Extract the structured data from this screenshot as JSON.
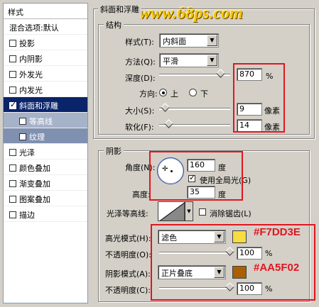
{
  "watermark": "www.68ps.com",
  "left_list": {
    "header": "样式",
    "items": [
      {
        "label": "混合选项:默认",
        "checkbox": false,
        "checked": false
      },
      {
        "label": "投影",
        "checkbox": true,
        "checked": false
      },
      {
        "label": "内阴影",
        "checkbox": true,
        "checked": false
      },
      {
        "label": "外发光",
        "checkbox": true,
        "checked": false
      },
      {
        "label": "内发光",
        "checkbox": true,
        "checked": false
      },
      {
        "label": "斜面和浮雕",
        "checkbox": true,
        "checked": true
      },
      {
        "label": "等高线",
        "checkbox": true,
        "checked": false
      },
      {
        "label": "纹理",
        "checkbox": true,
        "checked": false
      },
      {
        "label": "光泽",
        "checkbox": true,
        "checked": false
      },
      {
        "label": "颜色叠加",
        "checkbox": true,
        "checked": false
      },
      {
        "label": "渐变叠加",
        "checkbox": true,
        "checked": false
      },
      {
        "label": "图案叠加",
        "checkbox": true,
        "checked": false
      },
      {
        "label": "描边",
        "checkbox": true,
        "checked": false
      }
    ]
  },
  "bevel": {
    "title": "斜面和浮雕",
    "structure_title": "结构",
    "style_label": "样式(T):",
    "style_value": "内斜面",
    "technique_label": "方法(Q):",
    "technique_value": "平滑",
    "depth_label": "深度(D):",
    "depth_value": "870",
    "depth_unit": "%",
    "direction_label": "方向:",
    "direction_up": "上",
    "direction_down": "下",
    "size_label": "大小(S):",
    "size_value": "9",
    "size_unit": "像素",
    "soften_label": "软化(F):",
    "soften_value": "14",
    "soften_unit": "像素"
  },
  "shading": {
    "title": "阴影",
    "angle_label": "角度(N):",
    "angle_value": "160",
    "angle_unit": "度",
    "global_light_label": "使用全局光(G)",
    "altitude_label": "高度:",
    "altitude_value": "35",
    "altitude_unit": "度",
    "gloss_label": "光泽等高线:",
    "antialias_label": "消除锯齿(L)",
    "highlight_mode_label": "高光模式(H):",
    "highlight_mode_value": "滤色",
    "highlight_color": "#F7DD3E",
    "highlight_hex": "#F7DD3E",
    "opacity_label": "不透明度(O):",
    "highlight_opacity": "100",
    "opacity_unit": "%",
    "shadow_mode_label": "阴影模式(A):",
    "shadow_mode_value": "正片叠底",
    "shadow_color": "#AA5F02",
    "shadow_hex": "#AA5F02",
    "opacity_label2": "不透明度(C):",
    "shadow_opacity": "100",
    "opacity_unit2": "%"
  },
  "sliders": {
    "depth": 0.87,
    "size": 0.09,
    "soften": 0.14,
    "highlight_opacity": 1.0,
    "shadow_opacity": 1.0
  }
}
